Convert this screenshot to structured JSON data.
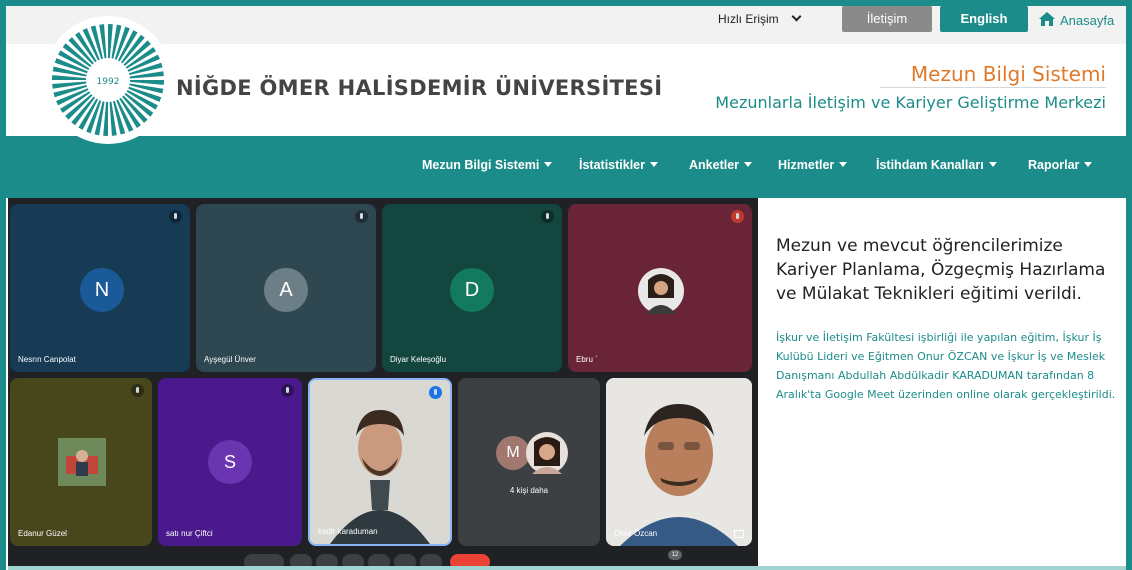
{
  "topbar": {
    "quick_access": "Hızlı Erişim",
    "contact_label": "İletişim",
    "english_label": "English",
    "home_label": "Anasayfa"
  },
  "header": {
    "logo_year": "1992",
    "university_name": "NİĞDE ÖMER HALİSDEMİR ÜNİVERSİTESİ",
    "system_title": "Mezun Bilgi Sistemi",
    "system_subtitle": "Mezunlarla İletişim ve Kariyer Geliştirme Merkezi"
  },
  "nav": {
    "items": [
      {
        "label": "Mezun Bilgi Sistemi"
      },
      {
        "label": "İstatistikler"
      },
      {
        "label": "Anketler"
      },
      {
        "label": "Hizmetler"
      },
      {
        "label": "İstihdam Kanalları"
      },
      {
        "label": "Raporlar"
      }
    ]
  },
  "meeting": {
    "tiles": [
      {
        "name": "Nesrın Canpolat",
        "initial": "N"
      },
      {
        "name": "Ayşegül Ünver",
        "initial": "A"
      },
      {
        "name": "Diyar Keleşoğlu",
        "initial": "D"
      },
      {
        "name": "Ebru `",
        "initial": ""
      },
      {
        "name": "Edanur Güzel",
        "initial": ""
      },
      {
        "name": "satı nur Çiftci",
        "initial": "S"
      },
      {
        "name": "kadir karaduman",
        "initial": ""
      },
      {
        "name": "4 kişi daha",
        "initial": "M"
      },
      {
        "name": "Onur Özcan",
        "initial": ""
      }
    ],
    "participant_count": "12"
  },
  "article": {
    "title": "Mezun ve mevcut öğrencilerimize Kariyer Planlama, Özgeçmiş Hazırlama ve Mülakat Teknikleri eğitimi verildi.",
    "body": "İşkur ve İletişim Fakültesi işbirliği ile yapılan eğitim, İşkur İş Kulübü Lideri ve Eğitmen Onur ÖZCAN ve İşkur İş ve Meslek Danışmanı Abdullah Abdülkadir KARADUMAN tarafından 8 Aralık'ta Google Meet üzerinden online olarak gerçekleştirildi."
  },
  "colors": {
    "brand_teal": "#1c8c8a",
    "accent_orange": "#e07a2a",
    "contact_gray": "#8a8a8a"
  }
}
